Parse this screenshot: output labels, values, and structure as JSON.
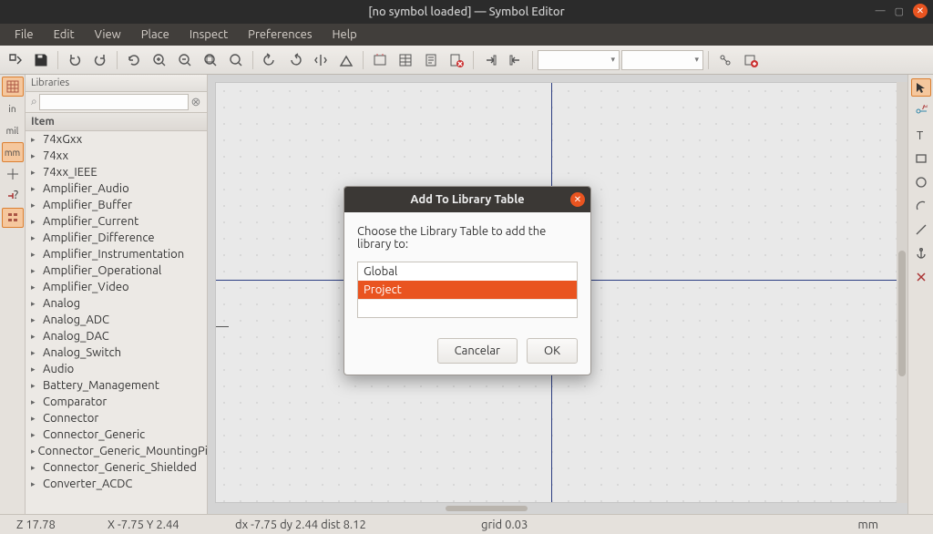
{
  "titlebar": {
    "title": "[no symbol loaded] — Symbol Editor"
  },
  "menu": {
    "file": "File",
    "edit": "Edit",
    "view": "View",
    "place": "Place",
    "inspect": "Inspect",
    "preferences": "Preferences",
    "help": "Help"
  },
  "left_strip": {
    "grid": "",
    "in": "in",
    "mil": "mil",
    "mm": "mm"
  },
  "library_panel": {
    "header": "Libraries",
    "search_placeholder": "",
    "search_value": "",
    "search_glyph": "⌕",
    "clear_glyph": "⊗",
    "column": "Item",
    "items": [
      "74xGxx",
      "74xx",
      "74xx_IEEE",
      "Amplifier_Audio",
      "Amplifier_Buffer",
      "Amplifier_Current",
      "Amplifier_Difference",
      "Amplifier_Instrumentation",
      "Amplifier_Operational",
      "Amplifier_Video",
      "Analog",
      "Analog_ADC",
      "Analog_DAC",
      "Analog_Switch",
      "Audio",
      "Battery_Management",
      "Comparator",
      "Connector",
      "Connector_Generic",
      "Connector_Generic_MountingPin",
      "Connector_Generic_Shielded",
      "Converter_ACDC"
    ]
  },
  "dialog": {
    "title": "Add To Library Table",
    "message": "Choose the Library Table to add the library to:",
    "options": {
      "global": "Global",
      "project": "Project"
    },
    "selected": "project",
    "cancel": "Cancelar",
    "ok": "OK"
  },
  "status": {
    "z": "Z 17.78",
    "xy": "X -7.75  Y 2.44",
    "dx": "dx -7.75  dy 2.44  dist 8.12",
    "grid": "grid 0.03",
    "unit": "mm"
  },
  "colors": {
    "accent": "#e95420",
    "crosshair": "#2c3e82"
  }
}
